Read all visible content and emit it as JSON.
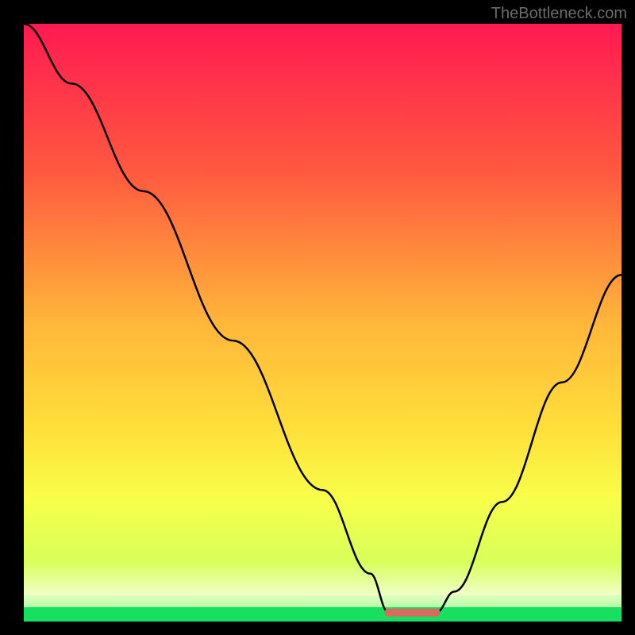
{
  "watermark": "TheBottleneck.com",
  "chart_data": {
    "type": "line",
    "title": "",
    "xlabel": "",
    "ylabel": "",
    "xlim": [
      0,
      100
    ],
    "ylim": [
      0,
      100
    ],
    "background": {
      "gradient": [
        "#ff1a52",
        "#ff6a3c",
        "#ffd83a",
        "#f7ff4a",
        "#17e060"
      ],
      "bottom_band_color": "#17e060",
      "bottom_band_height_pct": 3
    },
    "curve": {
      "description": "V-shaped bottleneck curve",
      "points": [
        {
          "x": 0,
          "y": 100
        },
        {
          "x": 8,
          "y": 90
        },
        {
          "x": 20,
          "y": 72
        },
        {
          "x": 35,
          "y": 47
        },
        {
          "x": 50,
          "y": 22
        },
        {
          "x": 58,
          "y": 8
        },
        {
          "x": 61,
          "y": 1.5
        },
        {
          "x": 69,
          "y": 1.5
        },
        {
          "x": 72,
          "y": 5
        },
        {
          "x": 80,
          "y": 20
        },
        {
          "x": 90,
          "y": 40
        },
        {
          "x": 100,
          "y": 58
        }
      ]
    },
    "trough_marker": {
      "x_start": 61,
      "x_end": 69,
      "y": 1.5,
      "color": "#d96a5e"
    }
  }
}
